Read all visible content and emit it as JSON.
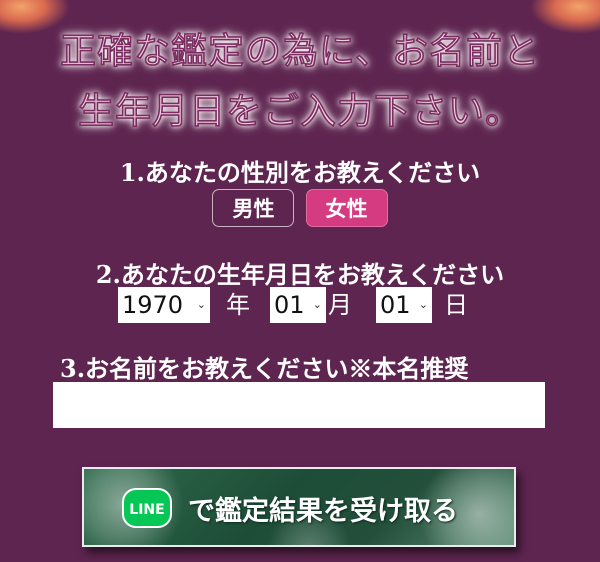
{
  "headline": {
    "line1": "正確な鑑定の為に、お名前と",
    "line2": "生年月日をご入力下さい。"
  },
  "gender": {
    "question": "1.あなたの性別をお教えください",
    "options": [
      {
        "label": "男性",
        "selected": false
      },
      {
        "label": "女性",
        "selected": true
      }
    ],
    "selected_color": "#d43b80"
  },
  "birthdate": {
    "question": "2.あなたの生年月日をお教えください",
    "year": "1970",
    "year_unit": "年",
    "month": "01",
    "month_unit": "月",
    "day": "01",
    "day_unit": "日"
  },
  "name": {
    "question": "3.お名前をお教えください※本名推奨",
    "value": ""
  },
  "submit": {
    "badge": "LINE",
    "label": "で鑑定結果を受け取る",
    "badge_color": "#06c755"
  },
  "theme": {
    "background": "#5e2550"
  }
}
